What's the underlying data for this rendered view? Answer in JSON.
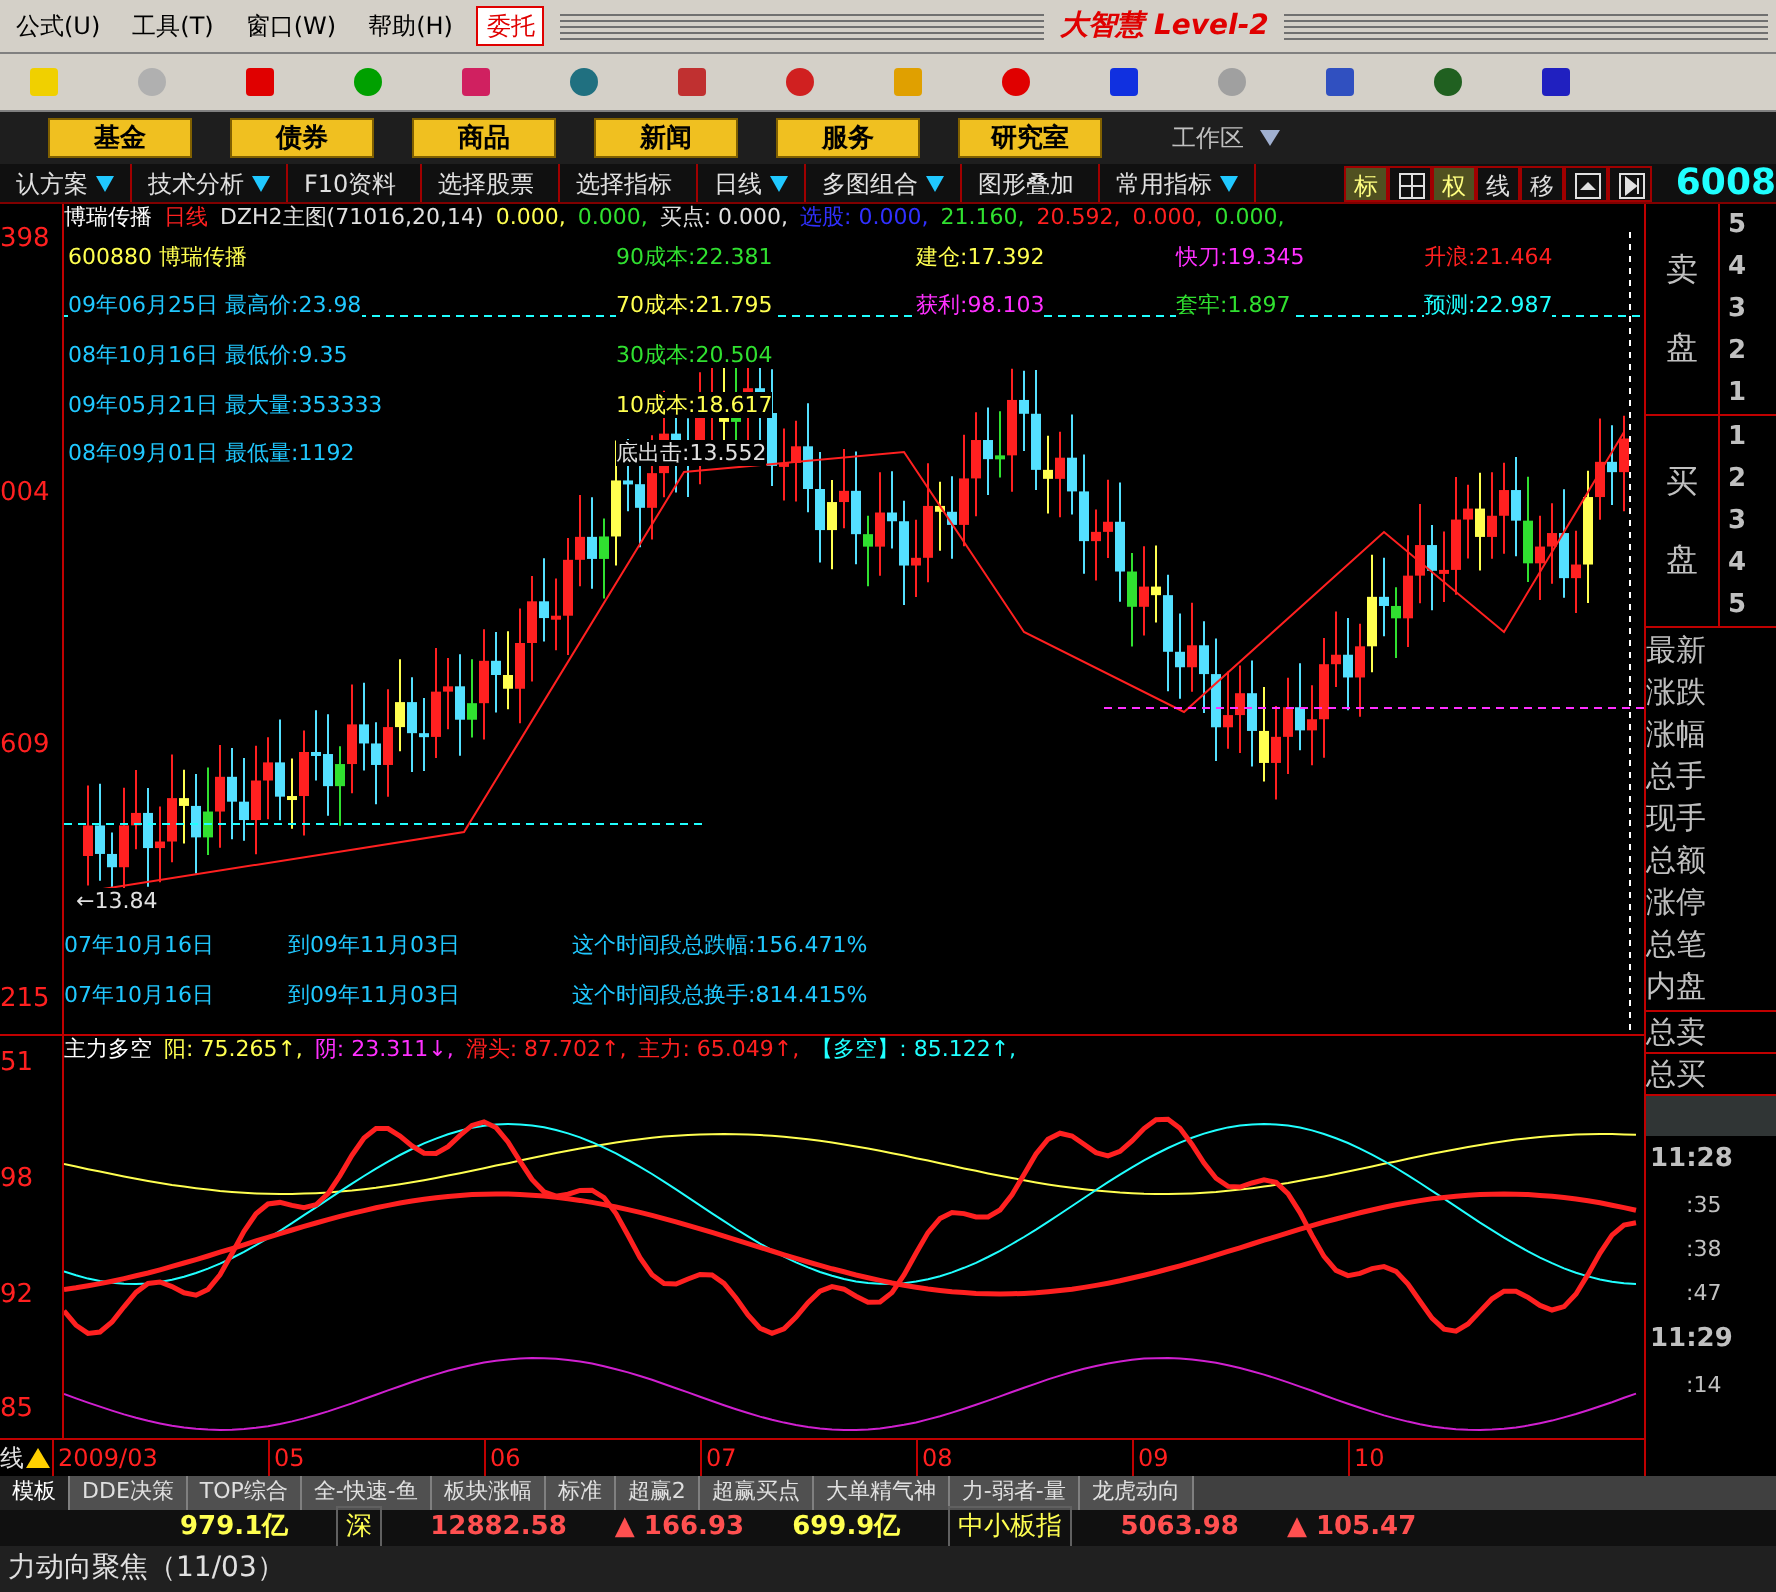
{
  "menu": [
    {
      "label": "公式(U)"
    },
    {
      "label": "工具(T)"
    },
    {
      "label": "窗口(W)"
    },
    {
      "label": "帮助(H)"
    },
    {
      "label": "委托",
      "kind": "trade"
    }
  ],
  "title": "大智慧 Level-2",
  "nav_buttons": [
    "基金",
    "债券",
    "商品",
    "新闻",
    "服务",
    "研究室"
  ],
  "workspace": "工作区",
  "function_bar": [
    {
      "label": "认方案",
      "dropdown": true
    },
    {
      "label": "技术分析",
      "dropdown": true
    },
    {
      "label": "F10资料"
    },
    {
      "label": "选择股票"
    },
    {
      "label": "选择指标"
    },
    {
      "label": "日线",
      "dropdown": true
    },
    {
      "label": "多图组合",
      "dropdown": true
    },
    {
      "label": "图形叠加"
    },
    {
      "label": "常用指标",
      "dropdown": true
    }
  ],
  "view_buttons": [
    {
      "kind": "text",
      "label": "标",
      "selected": true
    },
    {
      "kind": "grid"
    },
    {
      "kind": "text",
      "label": "权",
      "selected": true
    },
    {
      "kind": "text",
      "label": "线",
      "selected": false
    },
    {
      "kind": "text",
      "label": "移",
      "selected": false
    },
    {
      "kind": "up"
    },
    {
      "kind": "end"
    }
  ],
  "stock_code": "6008",
  "main_chart": {
    "y_labels": [
      "398",
      "004",
      "609",
      "215"
    ],
    "title": "博瑞传播",
    "header": [
      {
        "text": "日线",
        "color": "#ff2020"
      },
      {
        "text": "DZH2主图(71016,20,14)",
        "color": "#e0e0e0"
      },
      {
        "text": "0.000,",
        "color": "#ffff50"
      },
      {
        "text": "0.000,",
        "color": "#30e030"
      },
      {
        "text": "买点: 0.000,",
        "color": "#e0e0e0"
      },
      {
        "text": "选股: 0.000,",
        "color": "#3030ff"
      },
      {
        "text": "21.160,",
        "color": "#30e030"
      },
      {
        "text": "20.592,",
        "color": "#ff2020"
      },
      {
        "text": "0.000,",
        "color": "#ff2020"
      },
      {
        "text": "0.000,",
        "color": "#30e030"
      }
    ],
    "labels": [
      {
        "text": "600880 博瑞传播",
        "color": "#ffff50"
      },
      {
        "text": "09年06月25日 最高价:23.98",
        "color": "#20c8ff"
      },
      {
        "text": "08年10月16日 最低价:9.35",
        "color": "#20c8ff"
      },
      {
        "text": "09年05月21日 最大量:353333",
        "color": "#20c8ff"
      },
      {
        "text": "08年09月01日 最低量:1192",
        "color": "#20c8ff"
      },
      {
        "text": "90成本:22.381",
        "color": "#30e030"
      },
      {
        "text": "70成本:21.795",
        "color": "#ffff50"
      },
      {
        "text": "30成本:20.504",
        "color": "#30e030"
      },
      {
        "text": "10成本:18.617",
        "color": "#ffff50"
      },
      {
        "text": "底出击:13.552",
        "color": "#e0e0e0"
      },
      {
        "text": "建仓:17.392",
        "color": "#ffff50"
      },
      {
        "text": "获利:98.103",
        "color": "#ff30ff"
      },
      {
        "text": "快刀:19.345",
        "color": "#ff30ff"
      },
      {
        "text": "套牢:1.897",
        "color": "#30e030"
      },
      {
        "text": "升浪:21.464",
        "color": "#ff2020"
      },
      {
        "text": "预测:22.987",
        "color": "#20ffff"
      },
      {
        "text": "←13.84",
        "color": "#e0e0e0"
      },
      {
        "text": "07年10月16日",
        "color": "#20c8ff"
      },
      {
        "text": "到09年11月03日",
        "color": "#20c8ff"
      },
      {
        "text": "这个时间段总跌幅:156.471%",
        "color": "#20c8ff"
      },
      {
        "text": "07年10月16日",
        "color": "#20c8ff"
      },
      {
        "text": "到09年11月03日",
        "color": "#20c8ff"
      },
      {
        "text": "这个时间段总换手:814.415%",
        "color": "#20c8ff"
      }
    ]
  },
  "indicator": {
    "y_labels": [
      "51",
      "98",
      "92",
      "85"
    ],
    "name": "主力多空",
    "header": [
      {
        "text": "阳: 75.265↑,",
        "color": "#ffff50"
      },
      {
        "text": "阴: 23.311↓,",
        "color": "#ff30ff"
      },
      {
        "text": "滑头: 87.702↑,",
        "color": "#ff2020"
      },
      {
        "text": "主力: 65.049↑,",
        "color": "#ff2020"
      },
      {
        "text": "【多空】: 85.122↑,",
        "color": "#20ffff"
      }
    ]
  },
  "date_axis": {
    "label": "线",
    "dates": [
      "2009/03",
      "05",
      "06",
      "07",
      "08",
      "09",
      "10"
    ]
  },
  "tabs": [
    {
      "label": "模板",
      "selected": true
    },
    {
      "label": "DDE决策",
      "selected": false
    },
    {
      "label": "TOP综合",
      "selected": false
    },
    {
      "label": "全-快速-鱼",
      "selected": false
    },
    {
      "label": "板块涨幅",
      "selected": false
    },
    {
      "label": "标准",
      "selected": false
    },
    {
      "label": "超赢2",
      "selected": false
    },
    {
      "label": "超赢买点",
      "selected": false
    },
    {
      "label": "大单精气神",
      "selected": false
    },
    {
      "label": "力-弱者-量",
      "selected": false
    },
    {
      "label": "龙虎动向",
      "selected": false
    }
  ],
  "index_row": [
    {
      "kind": "amount",
      "text": "979.1亿"
    },
    {
      "kind": "market",
      "text": "深"
    },
    {
      "kind": "value",
      "text": "12882.58"
    },
    {
      "kind": "change",
      "text": "▲ 166.93"
    },
    {
      "kind": "amount",
      "text": "699.9亿"
    },
    {
      "kind": "market",
      "text": "中小板指"
    },
    {
      "kind": "value",
      "text": "5063.98"
    },
    {
      "kind": "change",
      "text": "▲ 105.47"
    }
  ],
  "status": "力动向聚焦（11/03）",
  "order_book": {
    "sell": {
      "label": "卖盘",
      "levels": [
        "5",
        "4",
        "3",
        "2",
        "1"
      ]
    },
    "buy": {
      "label": "买盘",
      "levels": [
        "1",
        "2",
        "3",
        "4",
        "5"
      ]
    },
    "fields": [
      "最新",
      "涨跌",
      "涨幅",
      "总手",
      "现手",
      "总额",
      "涨停",
      "总笔",
      "内盘"
    ],
    "totals": [
      "总卖",
      "总买"
    ]
  },
  "ticks": [
    {
      "kind": "minute",
      "time": "11:28"
    },
    {
      "kind": "second",
      "time": ":35"
    },
    {
      "kind": "second",
      "time": ":38"
    },
    {
      "kind": "second",
      "time": ":47"
    },
    {
      "kind": "minute",
      "time": "11:29"
    },
    {
      "kind": "second",
      "time": ":14"
    }
  ]
}
